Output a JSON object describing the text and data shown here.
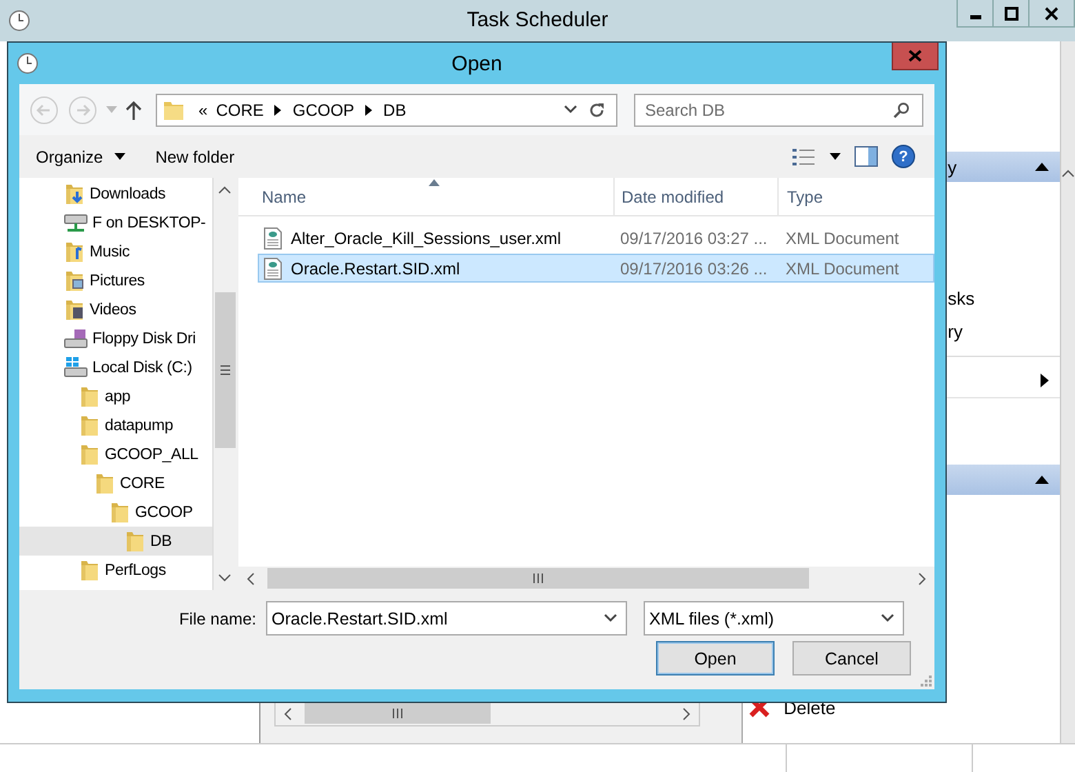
{
  "task_scheduler": {
    "title": "Task Scheduler",
    "actions": [
      {
        "kind": "header",
        "label": "y"
      },
      {
        "kind": "item"
      },
      {
        "kind": "item"
      },
      {
        "kind": "item"
      },
      {
        "kind": "item",
        "label": "sks"
      },
      {
        "kind": "item",
        "label": "ry"
      },
      {
        "kind": "separator"
      },
      {
        "kind": "submenu"
      },
      {
        "kind": "item"
      },
      {
        "kind": "item"
      },
      {
        "kind": "header"
      },
      {
        "kind": "delete",
        "label": "Delete"
      }
    ]
  },
  "dialog": {
    "title": "Open",
    "address": {
      "overflow": "«",
      "crumbs": [
        "CORE",
        "GCOOP",
        "DB"
      ]
    },
    "search": {
      "placeholder": "Search DB"
    },
    "toolbar": {
      "organize": "Organize",
      "new_folder": "New folder",
      "help": "?"
    },
    "tree": [
      {
        "label": "Downloads",
        "kind": "downloads",
        "selected": false
      },
      {
        "label": "F on DESKTOP-",
        "kind": "network",
        "selected": false
      },
      {
        "label": "Music",
        "kind": "music",
        "selected": false
      },
      {
        "label": "Pictures",
        "kind": "pictures",
        "selected": false
      },
      {
        "label": "Videos",
        "kind": "videos",
        "selected": false
      },
      {
        "label": "Floppy Disk Dri",
        "kind": "floppy",
        "selected": false
      },
      {
        "label": "Local Disk (C:)",
        "kind": "disk",
        "selected": false,
        "children": [
          {
            "label": "app",
            "kind": "folder",
            "selected": false
          },
          {
            "label": "datapump",
            "kind": "folder",
            "selected": false
          },
          {
            "label": "GCOOP_ALL",
            "kind": "folder",
            "selected": false,
            "children": [
              {
                "label": "CORE",
                "kind": "folder",
                "selected": false,
                "children": [
                  {
                    "label": "GCOOP",
                    "kind": "folder",
                    "selected": false,
                    "children": [
                      {
                        "label": "DB",
                        "kind": "folder",
                        "selected": true
                      }
                    ]
                  }
                ]
              }
            ]
          },
          {
            "label": "PerfLogs",
            "kind": "folder",
            "selected": false
          }
        ]
      }
    ],
    "columns": [
      "Name",
      "Date modified",
      "Type"
    ],
    "files": [
      {
        "name": "Alter_Oracle_Kill_Sessions_user.xml",
        "date": "09/17/2016 03:27 ...",
        "type": "XML Document",
        "selected": false
      },
      {
        "name": "Oracle.Restart.SID.xml",
        "date": "09/17/2016 03:26 ...",
        "type": "XML Document",
        "selected": true
      }
    ],
    "file_name": {
      "label": "File name:",
      "value": "Oracle.Restart.SID.xml"
    },
    "filter": "XML files (*.xml)",
    "buttons": [
      {
        "label": "Open",
        "default": true
      },
      {
        "label": "Cancel",
        "default": false
      }
    ]
  }
}
